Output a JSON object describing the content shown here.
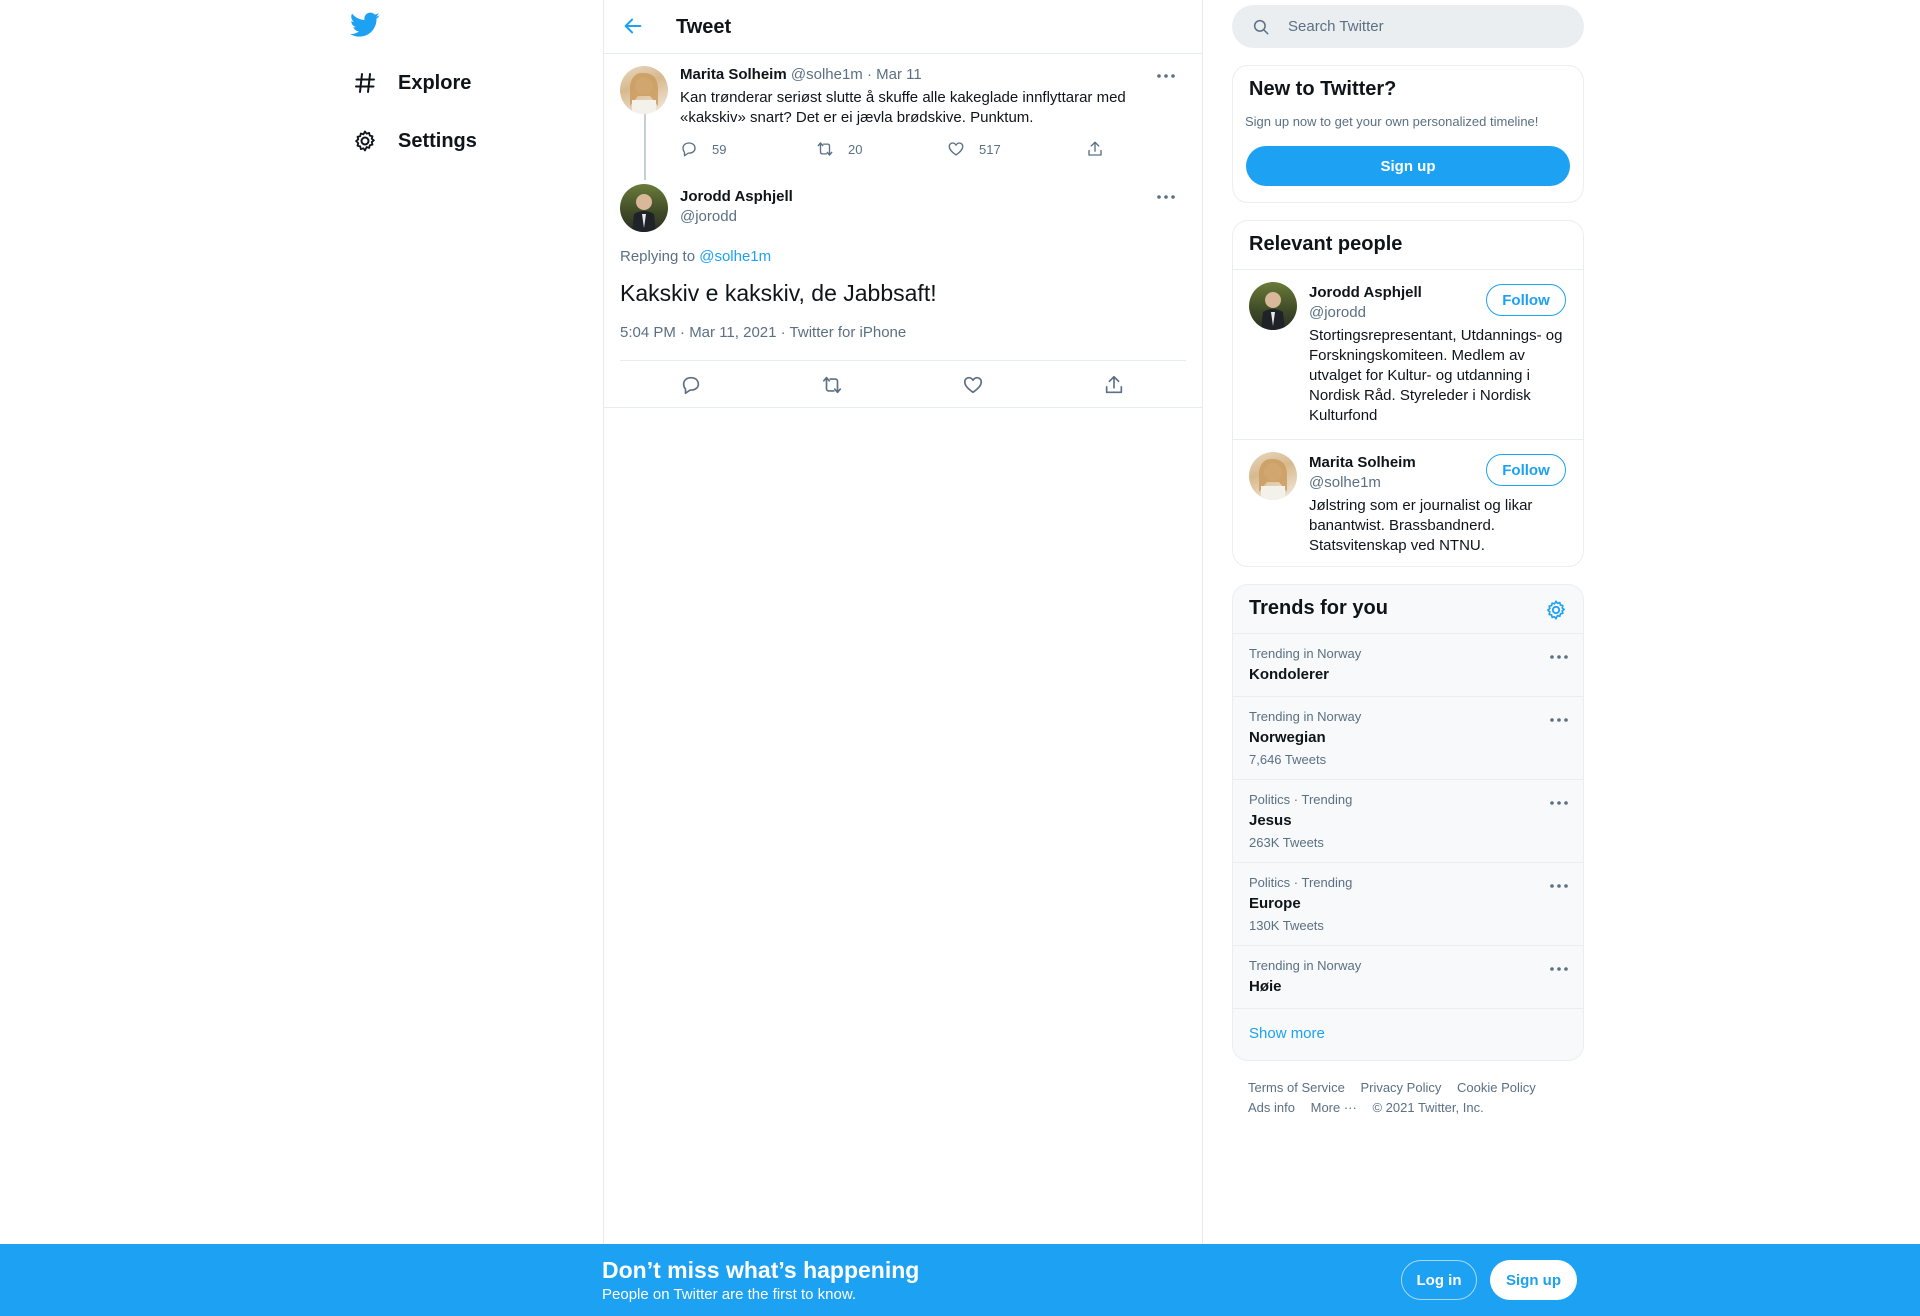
{
  "nav": {
    "items": [
      {
        "label": "Explore",
        "icon": "hashtag-icon"
      },
      {
        "label": "Settings",
        "icon": "gear-icon"
      }
    ]
  },
  "header": {
    "title": "Tweet"
  },
  "parent_tweet": {
    "name": "Marita Solheim",
    "handle": "@solhe1m",
    "date": "· Mar 11",
    "text": "Kan trønderar seriøst slutte å skuffe alle kakeglade innflyttarar med «kakskiv» snart? Det er ei jævla brødskive. Punktum.",
    "replies": "59",
    "retweets": "20",
    "likes": "517"
  },
  "main_tweet": {
    "name": "Jorodd Asphjell",
    "handle": "@jorodd",
    "replying_prefix": "Replying to",
    "replying_to": "@solhe1m",
    "text": "Kakskiv e kakskiv, de Jabbsaft!",
    "meta": "5:04 PM · Mar 11, 2021 · Twitter for iPhone"
  },
  "search": {
    "placeholder": "Search Twitter"
  },
  "new_to_twitter": {
    "title": "New to Twitter?",
    "subtitle": "Sign up now to get your own personalized timeline!",
    "button": "Sign up"
  },
  "relevant_people": {
    "title": "Relevant people",
    "people": [
      {
        "name": "Jorodd Asphjell",
        "handle": "@jorodd",
        "bio": "Stortingsrepresentant, Utdannings- og Forskningskomiteen. Medlem av utvalget for Kultur- og utdanning i Nordisk Råd. Styreleder i Nordisk Kulturfond",
        "follow": "Follow"
      },
      {
        "name": "Marita Solheim",
        "handle": "@solhe1m",
        "bio": "Jølstring som er journalist og likar banantwist. Brassbandnerd. Statsvitenskap ved NTNU.",
        "follow": "Follow"
      }
    ]
  },
  "trends": {
    "title": "Trends for you",
    "items": [
      {
        "context": "Trending in Norway",
        "name": "Kondolerer",
        "count": ""
      },
      {
        "context": "Trending in Norway",
        "name": "Norwegian",
        "count": "7,646 Tweets"
      },
      {
        "context": "Politics · Trending",
        "name": "Jesus",
        "count": "263K Tweets"
      },
      {
        "context": "Politics · Trending",
        "name": "Europe",
        "count": "130K Tweets"
      },
      {
        "context": "Trending in Norway",
        "name": "Høie",
        "count": ""
      }
    ],
    "show_more": "Show more"
  },
  "footer": {
    "terms": "Terms of Service",
    "privacy": "Privacy Policy",
    "cookie": "Cookie Policy",
    "ads": "Ads info",
    "more": "More ···",
    "copyright": "© 2021 Twitter, Inc."
  },
  "bottom_bar": {
    "title": "Don’t miss what’s happening",
    "subtitle": "People on Twitter are the first to know.",
    "login": "Log in",
    "signup": "Sign up"
  },
  "colors": {
    "accent": "#1da1f2",
    "muted": "#5b7083"
  }
}
